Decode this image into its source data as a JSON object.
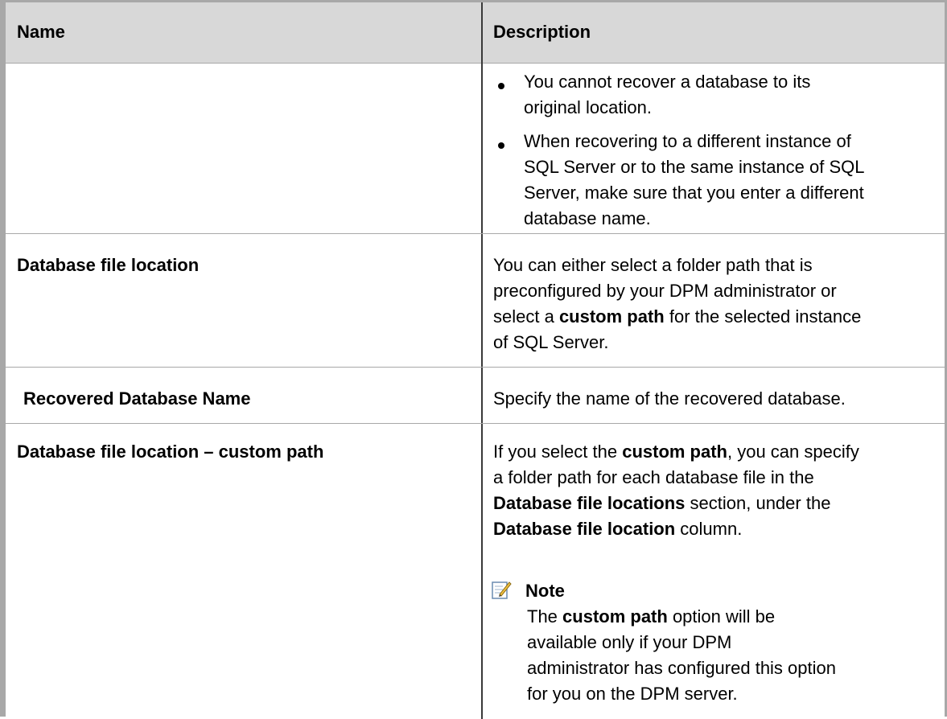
{
  "table": {
    "headers": {
      "name": "Name",
      "description": "Description"
    },
    "row0": {
      "name": "",
      "bullets": [
        "You cannot recover a database to its original location.",
        "When recovering to a different instance of SQL Server or to the same instance of SQL Server, make sure that you enter a different database name."
      ],
      "bullet1_lines": [
        "You cannot recover a database to its",
        "original location."
      ],
      "bullet2_lines": [
        "When recovering to a different instance of",
        "SQL Server or to the same instance of SQL",
        "Server, make sure that you enter a different",
        "database name."
      ]
    },
    "row1": {
      "name": "Database file location",
      "line1": "You can either select a folder path that is",
      "line2": "preconfigured by your DPM administrator or",
      "line3_pre": "select a ",
      "line3_bold": "custom path",
      "line3_post": " for the selected instance",
      "line4": "of SQL Server."
    },
    "row2": {
      "name": "Recovered Database Name",
      "description": "Specify the name of the recovered database."
    },
    "row3": {
      "name": "Database file location – custom path",
      "l1_pre": "If you select the ",
      "l1_bold": "custom path",
      "l1_post": ", you can specify",
      "l2": "a folder path for each database file in the",
      "l3_bold": "Database file locations",
      "l3_post": " section, under the",
      "l4_bold": "Database file location",
      "l4_post": " column.",
      "note_title": "Note",
      "note_l1_pre": "The ",
      "note_l1_bold": "custom path",
      "note_l1_post": " option will be",
      "note_l2": "available only if your DPM",
      "note_l3": "administrator has configured this option",
      "note_l4": "for you on the DPM server."
    }
  },
  "icons": {
    "note": "note-pencil-icon"
  }
}
